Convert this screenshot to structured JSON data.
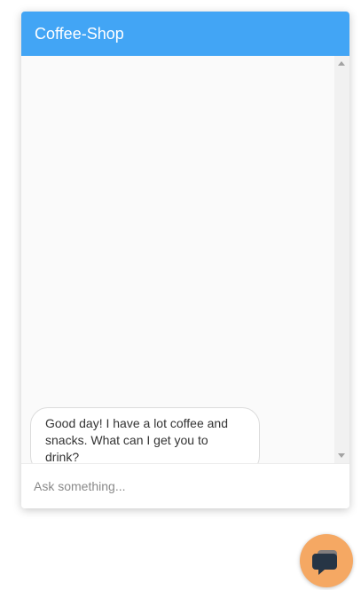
{
  "header": {
    "title": "Coffee-Shop",
    "color": "#42a5f5"
  },
  "messages": [
    {
      "sender": "bot",
      "text": "Good day! I have a lot coffee and snacks. What can I get you to drink?"
    }
  ],
  "input": {
    "placeholder": "Ask something...",
    "value": ""
  },
  "launcher": {
    "icon": "chat-bubble-icon",
    "color": "#f5a863"
  }
}
